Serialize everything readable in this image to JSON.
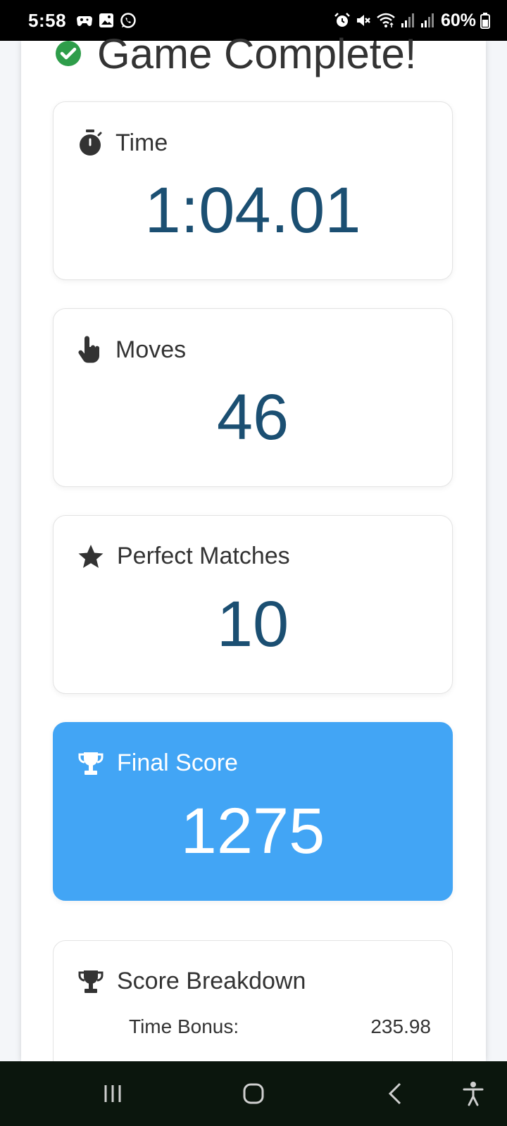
{
  "status_bar": {
    "time": "5:58",
    "left_icons": [
      "game-controller-icon",
      "gallery-icon",
      "whatsapp-icon"
    ],
    "right_icons": [
      "alarm-icon",
      "mute-icon",
      "wifi-icon",
      "signal-icon",
      "signal-icon"
    ],
    "battery_text": "60%"
  },
  "header": {
    "title": "Game Complete!",
    "icon": "check-circle-icon"
  },
  "stats": {
    "time": {
      "label": "Time",
      "value": "1:04.01",
      "icon": "stopwatch-icon"
    },
    "moves": {
      "label": "Moves",
      "value": "46",
      "icon": "hand-pointer-icon"
    },
    "perfect_matches": {
      "label": "Perfect Matches",
      "value": "10",
      "icon": "star-icon"
    },
    "final_score": {
      "label": "Final Score",
      "value": "1275",
      "icon": "trophy-icon"
    }
  },
  "breakdown": {
    "title": "Score Breakdown",
    "icon": "trophy-icon",
    "rows": [
      {
        "label": "Time Bonus:",
        "value": "235.98"
      }
    ]
  },
  "nav_bar": {
    "buttons": [
      "recents-icon",
      "home-icon",
      "back-icon",
      "accessibility-icon"
    ]
  },
  "colors": {
    "accent": "#42a5f5",
    "value_text": "#1b4f72",
    "success": "#2e9d4a",
    "nav_background": "#0b160d"
  }
}
